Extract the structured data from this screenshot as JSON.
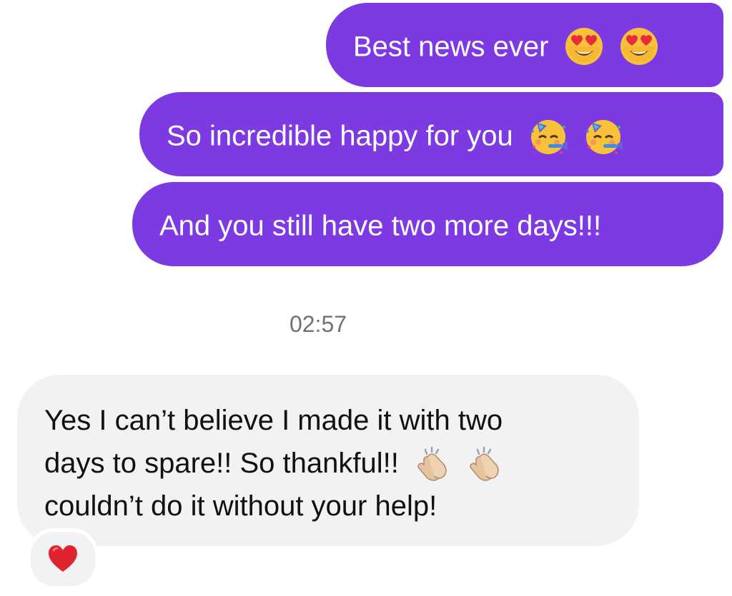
{
  "messages": {
    "outgoing": [
      {
        "text": "Best news ever",
        "emoji": [
          "heart-eyes-emoji",
          "heart-eyes-emoji"
        ]
      },
      {
        "text": "So incredible happy for you",
        "emoji": [
          "partying-face-emoji",
          "partying-face-emoji"
        ]
      },
      {
        "text": "And you still have two more days!!!"
      }
    ],
    "timestamp": "02:57",
    "incoming": {
      "lines": [
        "Yes I can’t believe I made it with two",
        "days to spare!! So thankful!!",
        "couldn’t do it without your help!"
      ],
      "emoji": [
        "clapping-hands-emoji",
        "clapping-hands-emoji"
      ],
      "reaction": "red-heart-emoji"
    }
  },
  "colors": {
    "outgoing_bubble": "#7d3ae3",
    "incoming_bubble": "#f1f2f4",
    "timestamp_text": "#6f7277"
  }
}
